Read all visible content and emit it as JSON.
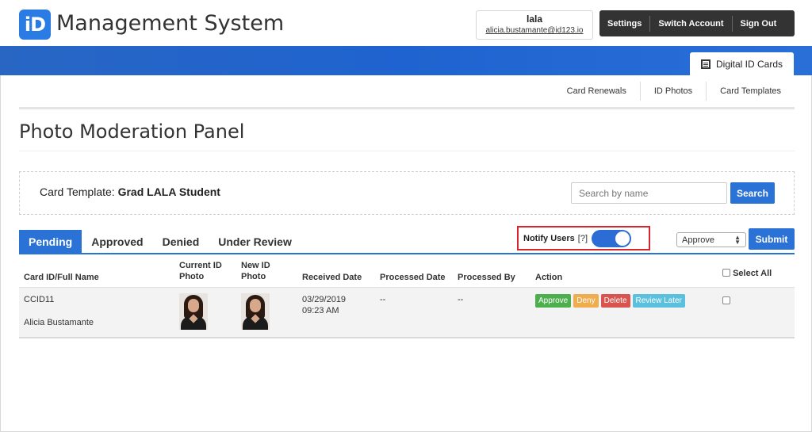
{
  "header": {
    "logo_text": "iD",
    "app_title": "Management System",
    "user_name": "lala",
    "user_email": "alicia.bustamante@id123.io",
    "actions": [
      "Settings",
      "Switch Account",
      "Sign Out"
    ]
  },
  "module_tab": "Digital ID Cards",
  "subnav": [
    "Card Renewals",
    "ID Photos",
    "Card Templates"
  ],
  "page_title": "Photo Moderation Panel",
  "template": {
    "label": "Card Template:",
    "value": "Grad LALA Student"
  },
  "search": {
    "placeholder": "Search by name",
    "button": "Search"
  },
  "tabs": [
    "Pending",
    "Approved",
    "Denied",
    "Under Review"
  ],
  "active_tab": "Pending",
  "notify": {
    "label": "Notify Users",
    "help": "[?]",
    "enabled": true
  },
  "bulk_action": {
    "selected": "Approve",
    "submit": "Submit"
  },
  "table": {
    "headers": {
      "id": "Card ID/Full Name",
      "current_photo_1": "Current ID",
      "current_photo_2": "Photo",
      "new_photo_1": "New ID",
      "new_photo_2": "Photo",
      "received": "Received Date",
      "processed_date": "Processed Date",
      "processed_by": "Processed By",
      "action": "Action",
      "select_all": "Select All"
    },
    "rows": [
      {
        "card_id": "CCID11",
        "full_name": "Alicia Bustamante",
        "received_date": "03/29/2019",
        "received_time": "09:23 AM",
        "processed_date": "--",
        "processed_by": "--",
        "actions": [
          "Approve",
          "Deny",
          "Delete",
          "Review Later"
        ]
      }
    ]
  },
  "colors": {
    "primary": "#2a72d6",
    "approve": "#4cae4c",
    "deny": "#f0ad4e",
    "delete": "#d9534f",
    "review": "#5bc0de",
    "highlight": "#d9252b"
  }
}
